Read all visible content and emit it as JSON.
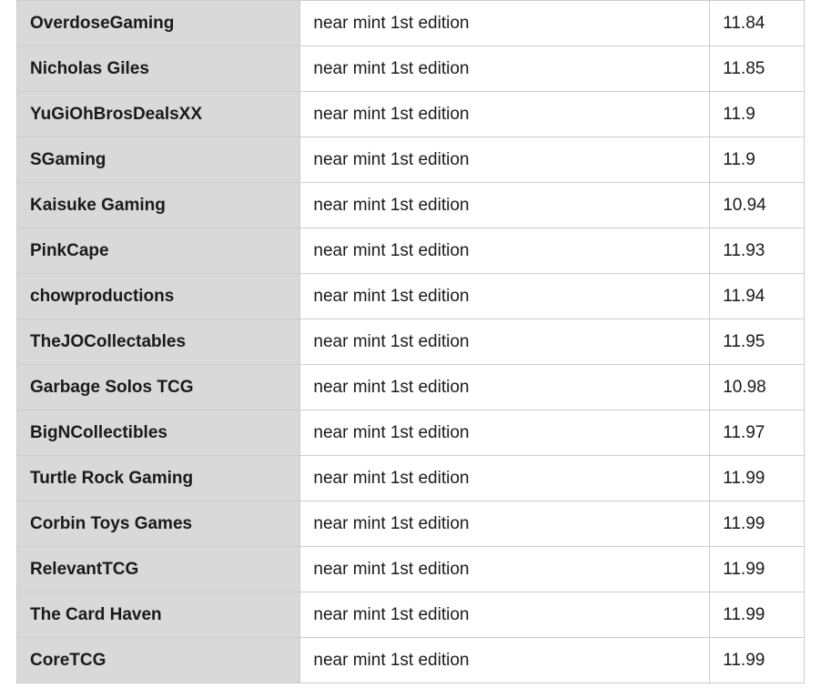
{
  "rows": [
    {
      "seller": "OverdoseGaming",
      "condition": "near mint 1st edition",
      "price": "11.84"
    },
    {
      "seller": "Nicholas Giles",
      "condition": "near mint 1st edition",
      "price": "11.85"
    },
    {
      "seller": "YuGiOhBrosDealsXX",
      "condition": "near mint 1st edition",
      "price": "11.9"
    },
    {
      "seller": "SGaming",
      "condition": "near mint 1st edition",
      "price": "11.9"
    },
    {
      "seller": "Kaisuke Gaming",
      "condition": "near mint 1st edition",
      "price": "10.94"
    },
    {
      "seller": "PinkCape",
      "condition": "near mint 1st edition",
      "price": "11.93"
    },
    {
      "seller": "chowproductions",
      "condition": "near mint 1st edition",
      "price": "11.94"
    },
    {
      "seller": "TheJOCollectables",
      "condition": "near mint 1st edition",
      "price": "11.95"
    },
    {
      "seller": "Garbage Solos TCG",
      "condition": "near mint 1st edition",
      "price": "10.98"
    },
    {
      "seller": "BigNCollectibles",
      "condition": "near mint 1st edition",
      "price": "11.97"
    },
    {
      "seller": "Turtle Rock Gaming",
      "condition": "near mint 1st edition",
      "price": "11.99"
    },
    {
      "seller": "Corbin Toys Games",
      "condition": "near mint 1st edition",
      "price": "11.99"
    },
    {
      "seller": "RelevantTCG",
      "condition": "near mint 1st edition",
      "price": "11.99"
    },
    {
      "seller": "The Card Haven",
      "condition": "near mint 1st edition",
      "price": "11.99"
    },
    {
      "seller": "CoreTCG",
      "condition": "near mint 1st edition",
      "price": "11.99"
    }
  ]
}
